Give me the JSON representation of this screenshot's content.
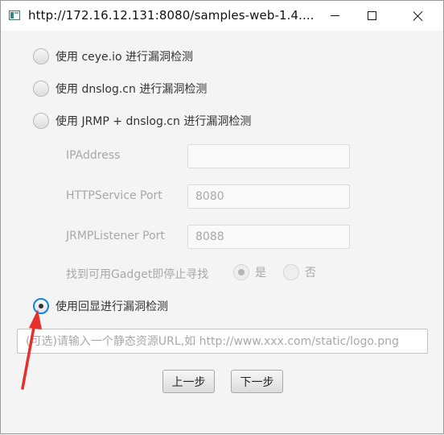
{
  "window": {
    "title": "http://172.16.12.131:8080/samples-web-1.4....",
    "controls": {
      "minimize": "minimize-icon",
      "maximize": "maximize-icon",
      "close": "close-icon"
    }
  },
  "options": {
    "ceye": "使用 ceye.io 进行漏洞检测",
    "dnslog": "使用 dnslog.cn 进行漏洞检测",
    "jrmp": "使用 JRMP + dnslog.cn 进行漏洞检测",
    "echo": "使用回显进行漏洞检测",
    "selected": "echo"
  },
  "jrmp_settings": {
    "ip_label": "IPAddress",
    "ip_value": "",
    "http_label": "HTTPService Port",
    "http_value": "8080",
    "listener_label": "JRMPListener Port",
    "listener_value": "8088",
    "gadget_label": "找到可用Gadget即停止寻找",
    "yes_label": "是",
    "no_label": "否",
    "gadget_selected": "yes"
  },
  "static_url": {
    "placeholder": "(可选)请输入一个静态资源URL,如 http://www.xxx.com/static/logo.png",
    "value": ""
  },
  "buttons": {
    "prev": "上一步",
    "next": "下一步"
  },
  "annotation": {
    "arrow_color": "#e8302a"
  }
}
